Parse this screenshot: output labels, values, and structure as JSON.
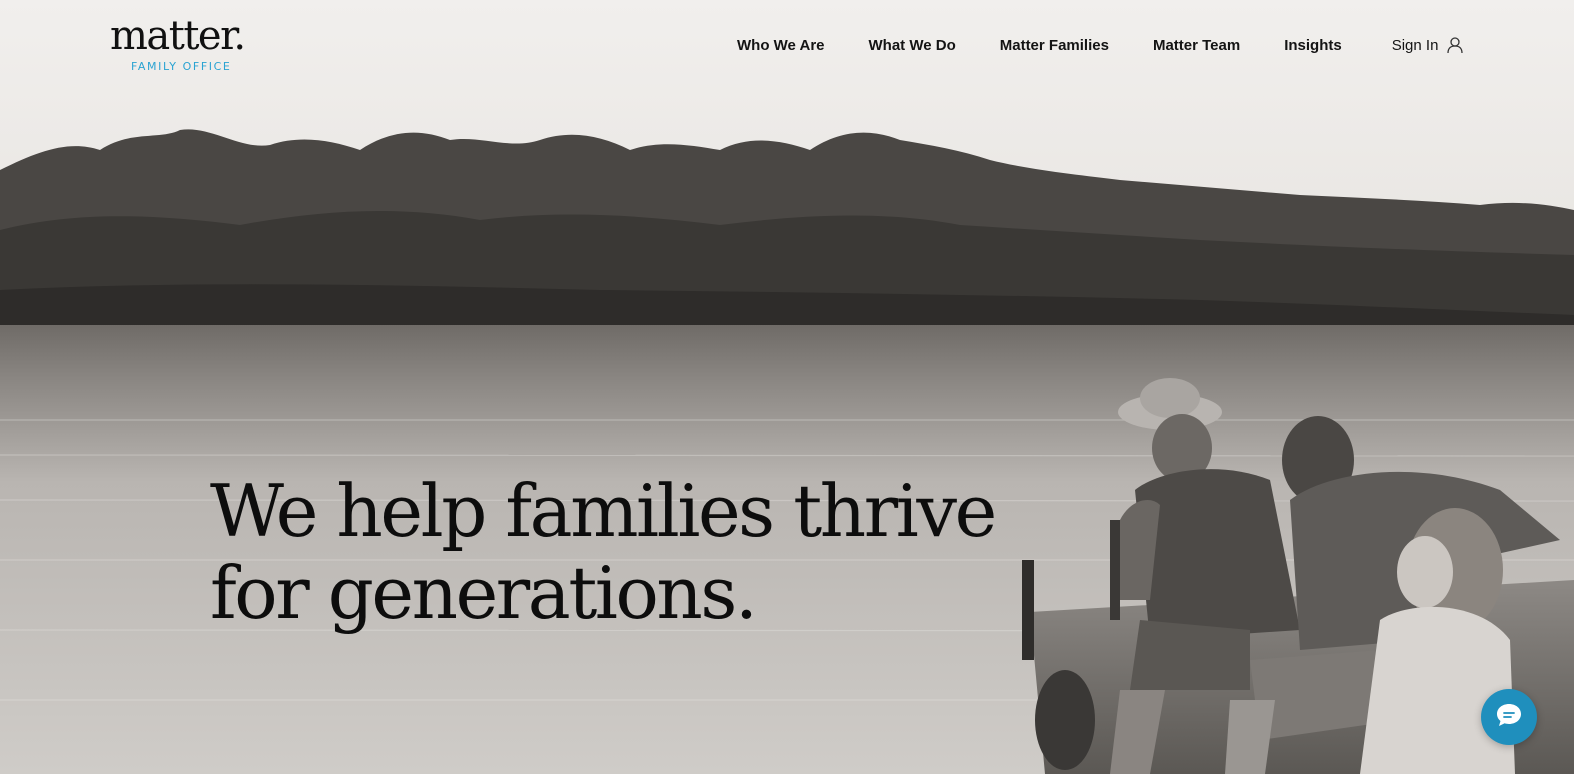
{
  "logo": {
    "wordmark": "matter.",
    "subtitle": "FAMILY OFFICE"
  },
  "nav": {
    "items": [
      {
        "label": "Who We Are"
      },
      {
        "label": "What We Do"
      },
      {
        "label": "Matter Families"
      },
      {
        "label": "Matter Team"
      },
      {
        "label": "Insights"
      }
    ],
    "sign_in": "Sign In",
    "sign_in_icon": "user-icon"
  },
  "hero": {
    "headline_line1": "We help families thrive",
    "headline_line2": "for generations.",
    "image": "black-and-white photo of lake, treeline and family sitting on a dock"
  },
  "chat": {
    "icon": "chat-bubble-icon",
    "color": "#1f8fbd"
  },
  "colors": {
    "accent": "#2aa3d2",
    "text": "#141414"
  }
}
